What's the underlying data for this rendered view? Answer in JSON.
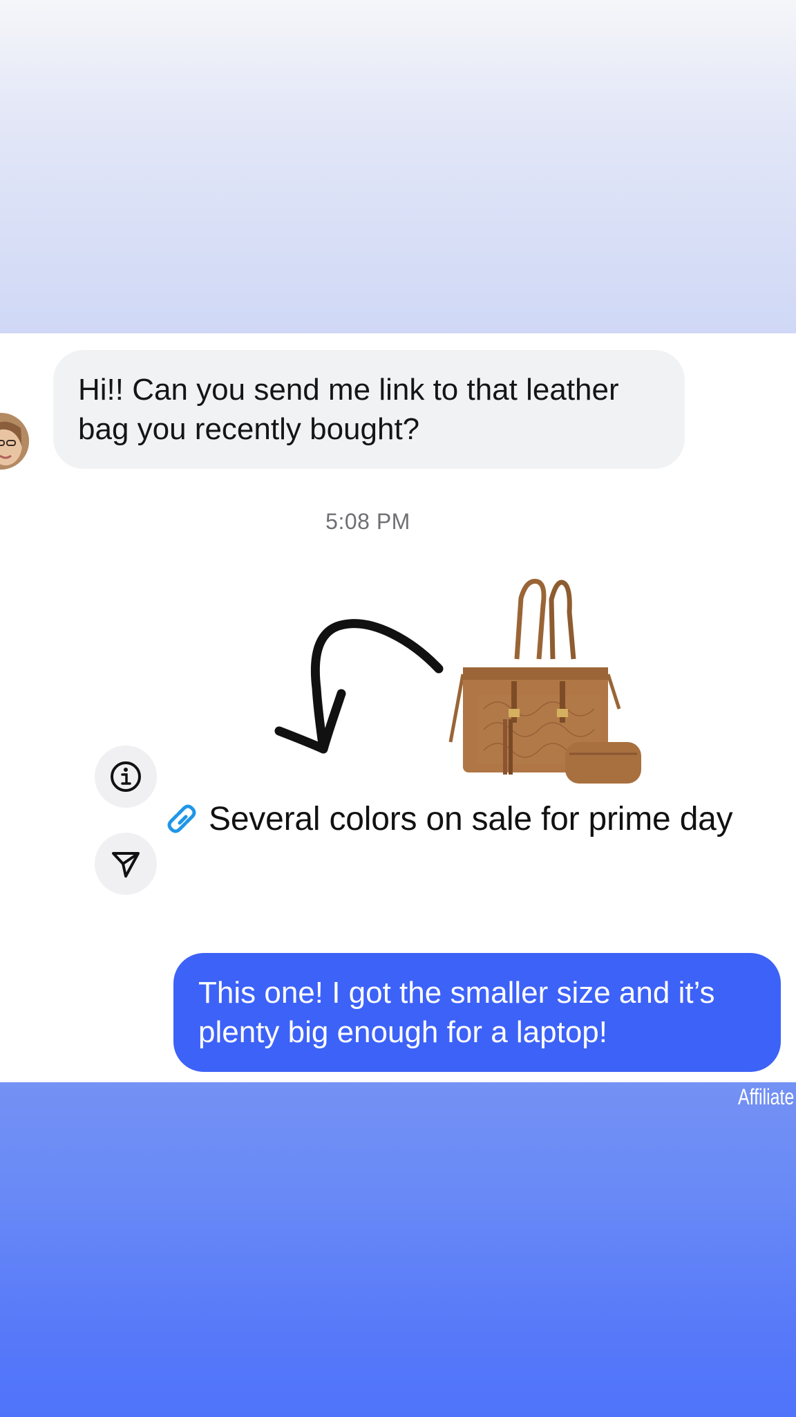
{
  "conversation": {
    "incoming_message": "Hi!! Can you send me link to that leather bag you recently bought?",
    "timestamp": "5:08 PM",
    "shared_link": {
      "icon": "link-icon",
      "text": "Several colors on sale for prime day"
    },
    "outgoing_message": "This one! I got the smaller size and it’s plenty big enough for a laptop!"
  },
  "actions": {
    "info_icon": "info-icon",
    "share_icon": "send-icon"
  },
  "overlay": {
    "affiliate_label": "Affiliate"
  },
  "colors": {
    "incoming_bubble": "#f1f2f4",
    "outgoing_bubble": "#3d62f8",
    "link_icon": "#1f96e8",
    "top_gradient": "#cfd8f6",
    "bottom_gradient": "#4f73fa"
  }
}
